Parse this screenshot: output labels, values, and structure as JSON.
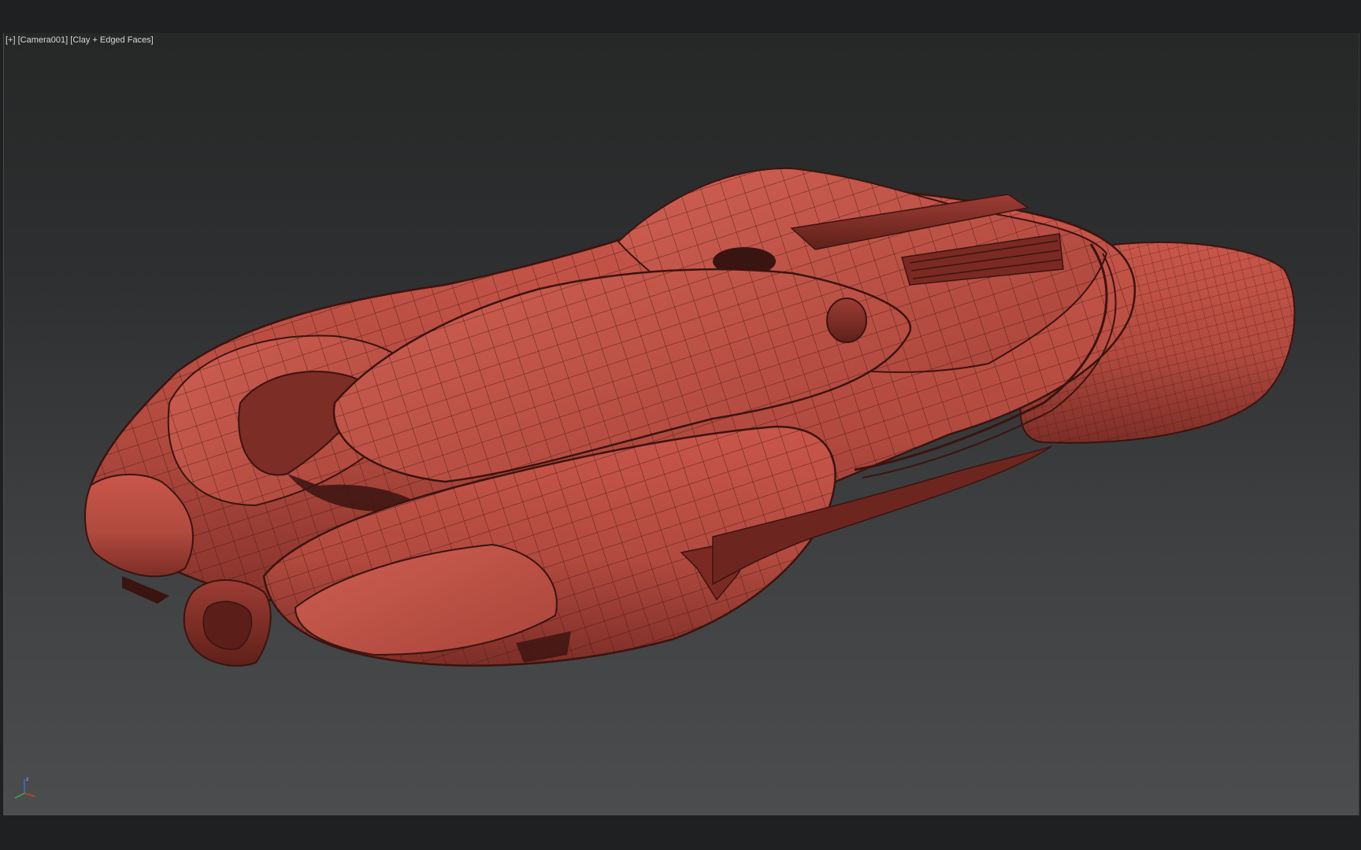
{
  "viewport": {
    "label_plus": "[+]",
    "label_camera": "[Camera001]",
    "label_shading": "[Clay + Edged Faces]"
  },
  "model": {
    "name_icon": "hover-car-mesh-icon",
    "clay_color": "#b84a40",
    "wire_color": "#3a1410"
  },
  "gizmo": {
    "axis_z_label": "z",
    "axis_x_color": "#d33a2c",
    "axis_y_color": "#3cb043",
    "axis_z_color": "#3b6fd6"
  }
}
